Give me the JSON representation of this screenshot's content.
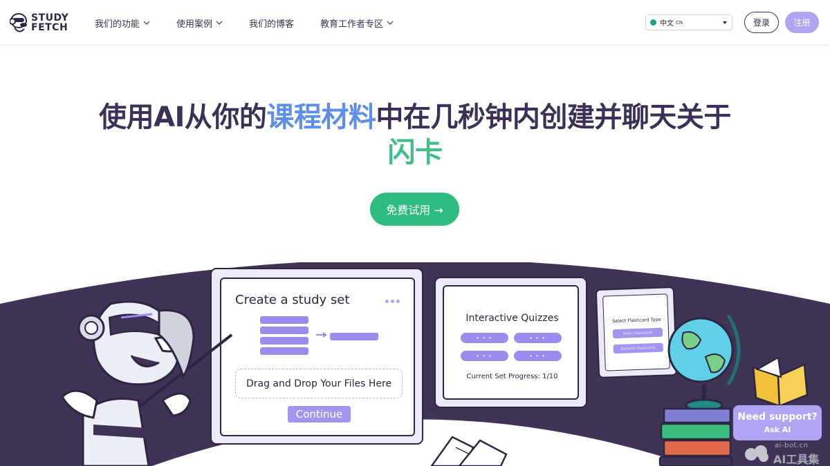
{
  "brand": {
    "logo_line1": "STUDY",
    "logo_line2": "FETCH"
  },
  "nav": [
    {
      "label": "我们的功能",
      "has_dropdown": true
    },
    {
      "label": "使用案例",
      "has_dropdown": true
    },
    {
      "label": "我们的博客",
      "has_dropdown": false
    },
    {
      "label": "教育工作者专区",
      "has_dropdown": true
    }
  ],
  "language": {
    "label": "中文",
    "code": "CN"
  },
  "auth": {
    "login": "登录",
    "signup": "注册"
  },
  "hero": {
    "title_part1": "使用AI从你的",
    "title_highlight1": "课程材料",
    "title_part2": "中在几秒钟内创建并聊天关于",
    "title_highlight2": "闪卡",
    "cta": "免费试用 →"
  },
  "illustration": {
    "create_card": {
      "title": "Create a study set",
      "dropzone": "Drag and Drop Your Files Here",
      "continue": "Continue"
    },
    "quiz_card": {
      "title": "Interactive Quizzes",
      "pill": "• • •",
      "progress": "Current Set Progress:  1/10"
    },
    "flashcard_card": {
      "title": "Select Flashcard Type",
      "option1": "Static Flashcards",
      "option2": "Dynamic Flashcards"
    }
  },
  "support": {
    "title": "Need support?",
    "subtitle": "Ask AI"
  },
  "watermark": {
    "domain": "ai-bot.cn",
    "name": "AI工具集"
  },
  "colors": {
    "primary_purple": "#b1a4f2",
    "accent_blue": "#5d8ee8",
    "accent_green": "#3fbf86",
    "cta_green": "#2ebd80",
    "dark_navy": "#3b3158",
    "wave": "#3f3358"
  }
}
